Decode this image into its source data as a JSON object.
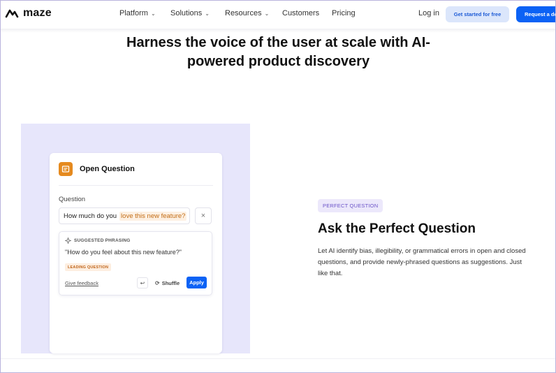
{
  "nav": {
    "logo_text": "maze",
    "items": [
      {
        "label": "Platform",
        "has_dropdown": true
      },
      {
        "label": "Solutions",
        "has_dropdown": true
      },
      {
        "label": "Resources",
        "has_dropdown": true
      },
      {
        "label": "Customers",
        "has_dropdown": false
      },
      {
        "label": "Pricing",
        "has_dropdown": false
      }
    ],
    "login": "Log in",
    "get_started": "Get started for free",
    "request_demo": "Request a demo"
  },
  "hero": {
    "title": "Harness the voice of the user at scale with AI-powered product discovery"
  },
  "illustration": {
    "card_title": "Open Question",
    "question_label": "Question",
    "question_prefix": "How much do you",
    "question_highlight": "love this new feature?",
    "close_symbol": "×",
    "suggested_label": "SUGGESTED PHRASING",
    "suggested_text": "\"How do you feel about this new feature?\"",
    "badge": "LEADING QUESTION",
    "feedback_link": "Give feedback",
    "undo_symbol": "↩",
    "shuffle_label": "Shuffle",
    "apply_label": "Apply"
  },
  "feature": {
    "pill": "PERFECT QUESTION",
    "title": "Ask the Perfect Question",
    "description": "Let AI identify bias, illegibility, or grammatical errors in open and closed questions, and provide newly-phrased questions as suggestions. Just like that."
  },
  "colors": {
    "primary": "#0b62f5",
    "panel_bg": "#e7e6fb",
    "accent_orange": "#e58a1f",
    "pill_text": "#6b53c8"
  }
}
